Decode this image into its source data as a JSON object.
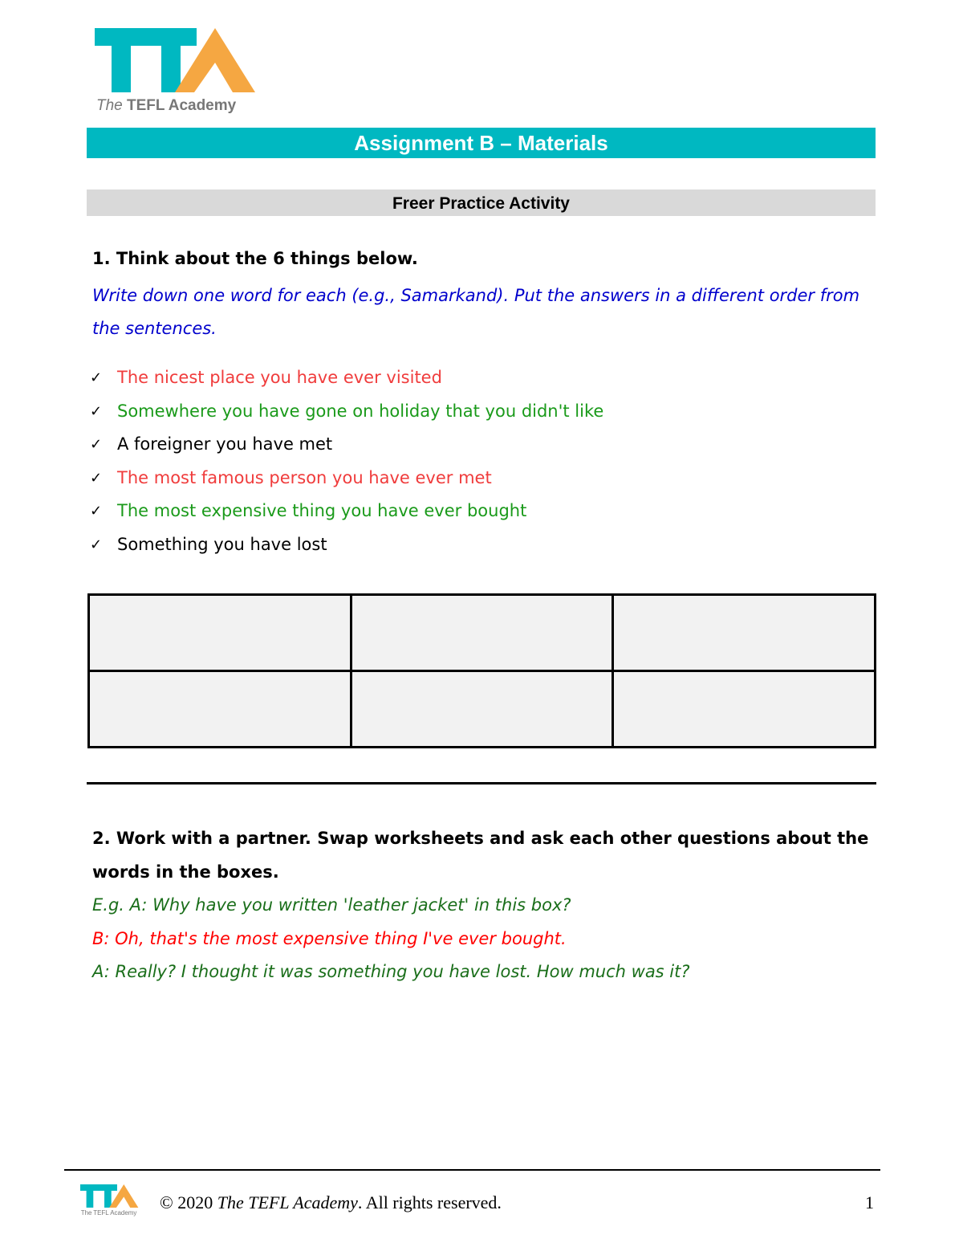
{
  "brand": {
    "logo_letters": "TTA",
    "logo_caption_light": "The",
    "logo_caption_bold": "TEFL Academy",
    "primary_color": "#00b8c1",
    "accent_color": "#f5a742"
  },
  "header": {
    "title": "Assignment B – Materials",
    "subtitle": "Freer Practice Activity"
  },
  "section1": {
    "heading": "1. Think about the 6 things below.",
    "instruction": "Write down one word for each (e.g., Samarkand). Put the answers in a different order from the sentences.",
    "check_icon": "✓",
    "items": [
      {
        "text": "The nicest place you have ever visited",
        "color": "red"
      },
      {
        "text": "Somewhere you have gone on holiday that you didn't like",
        "color": "green"
      },
      {
        "text": "A foreigner you have met",
        "color": "black"
      },
      {
        "text": "The most famous person you have ever met",
        "color": "red"
      },
      {
        "text": "The most expensive thing you have ever bought",
        "color": "green"
      },
      {
        "text": "Something you have lost",
        "color": "black"
      }
    ],
    "answer_boxes": [
      "",
      "",
      "",
      "",
      "",
      ""
    ]
  },
  "section2": {
    "heading": "2. Work with a partner. Swap worksheets and ask each other questions about the words in the boxes.",
    "dialog": [
      {
        "text": "E.g. A: Why have you written 'leather jacket' in this box?",
        "color": "dark-green"
      },
      {
        "text": "B: Oh, that's the most expensive thing I've ever bought.",
        "color": "red"
      },
      {
        "text": "A: Really? I thought it was something you have lost. How much was it?",
        "color": "dark-green"
      }
    ]
  },
  "footer": {
    "copyright_prefix": "© 2020 ",
    "copyright_org": "The TEFL Academy",
    "copyright_suffix": ". All rights reserved.",
    "page_number": "1"
  }
}
